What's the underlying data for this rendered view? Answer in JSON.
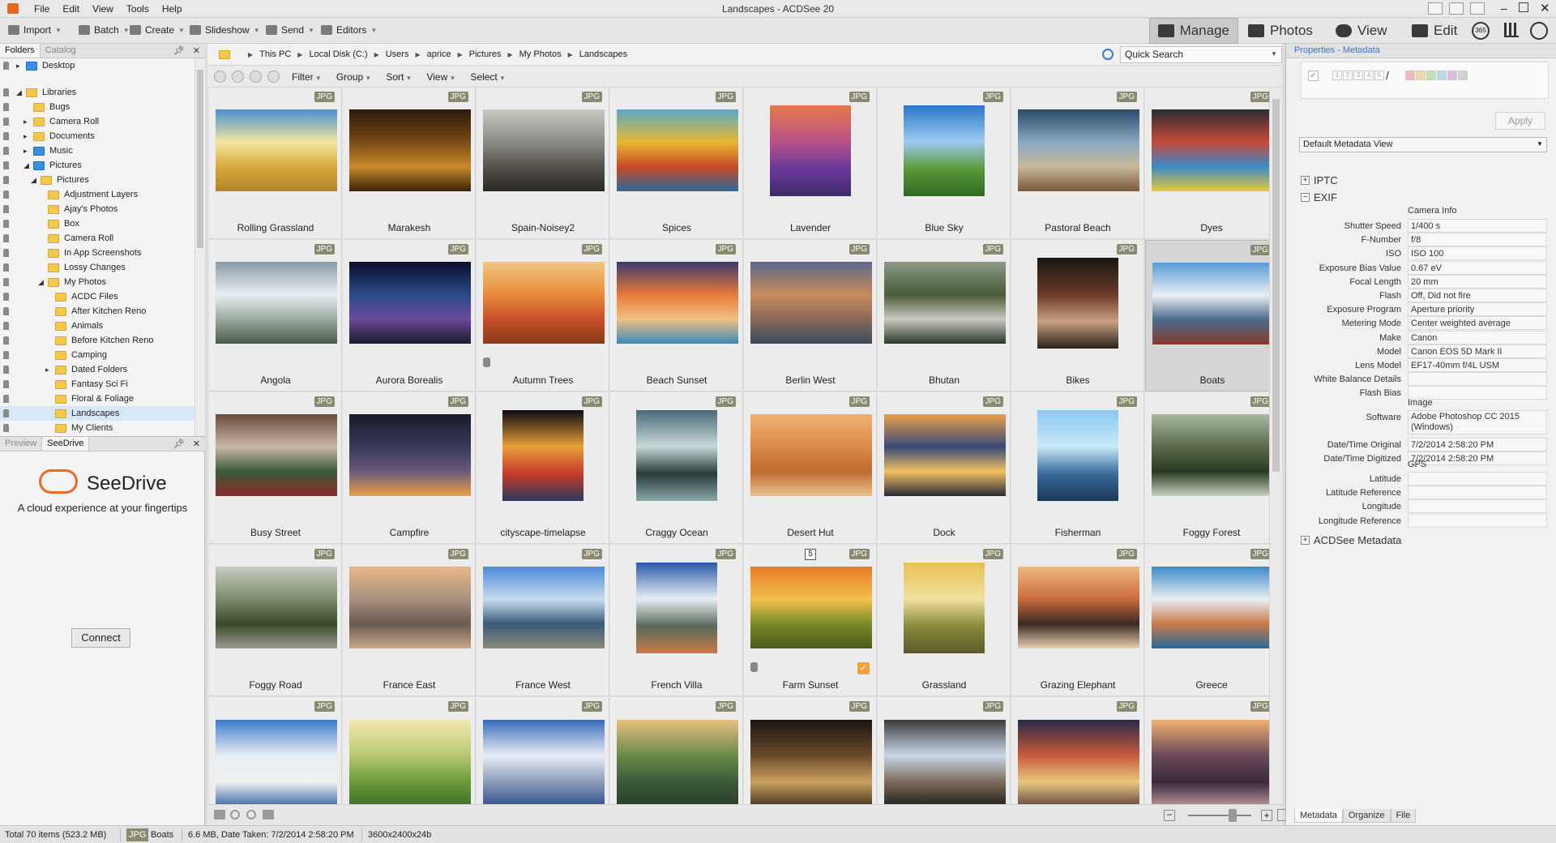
{
  "window": {
    "title": "Landscapes - ACDSee 20"
  },
  "menu": [
    "File",
    "Edit",
    "View",
    "Tools",
    "Help"
  ],
  "toolbar": {
    "import": "Import",
    "batch": "Batch",
    "create": "Create",
    "slideshow": "Slideshow",
    "send": "Send",
    "editors": "Editors"
  },
  "modes": {
    "manage": "Manage",
    "photos": "Photos",
    "view": "View",
    "edit": "Edit",
    "365_badge": "365"
  },
  "left_panel": {
    "tabs": [
      "Folders",
      "Catalog"
    ],
    "tree": [
      {
        "label": "Desktop",
        "level": 0,
        "icon": "blue-folder",
        "exp": "▸"
      },
      {
        "label": "Libraries",
        "level": 0,
        "icon": "folder",
        "exp": "◢"
      },
      {
        "label": "Bugs",
        "level": 1,
        "icon": "folder",
        "exp": ""
      },
      {
        "label": "Camera Roll",
        "level": 1,
        "icon": "folder",
        "exp": "▸"
      },
      {
        "label": "Documents",
        "level": 1,
        "icon": "folder",
        "exp": "▸"
      },
      {
        "label": "Music",
        "level": 1,
        "icon": "blue-folder",
        "exp": "▸"
      },
      {
        "label": "Pictures",
        "level": 1,
        "icon": "blue-folder",
        "exp": "◢"
      },
      {
        "label": "Pictures",
        "level": 2,
        "icon": "folder",
        "exp": "◢"
      },
      {
        "label": "Adjustment Layers",
        "level": 3,
        "icon": "folder",
        "exp": ""
      },
      {
        "label": "Ajay's Photos",
        "level": 3,
        "icon": "folder",
        "exp": ""
      },
      {
        "label": "Box",
        "level": 3,
        "icon": "folder",
        "exp": ""
      },
      {
        "label": "Camera Roll",
        "level": 3,
        "icon": "folder",
        "exp": ""
      },
      {
        "label": "In App Screenshots",
        "level": 3,
        "icon": "folder",
        "exp": ""
      },
      {
        "label": "Lossy Changes",
        "level": 3,
        "icon": "folder",
        "exp": ""
      },
      {
        "label": "My Photos",
        "level": 3,
        "icon": "folder",
        "exp": "◢"
      },
      {
        "label": "ACDC Files",
        "level": 4,
        "icon": "folder",
        "exp": ""
      },
      {
        "label": "After Kitchen Reno",
        "level": 4,
        "icon": "folder",
        "exp": ""
      },
      {
        "label": "Animals",
        "level": 4,
        "icon": "folder",
        "exp": ""
      },
      {
        "label": "Before Kitchen Reno",
        "level": 4,
        "icon": "folder",
        "exp": ""
      },
      {
        "label": "Camping",
        "level": 4,
        "icon": "folder",
        "exp": ""
      },
      {
        "label": "Dated Folders",
        "level": 4,
        "icon": "folder",
        "exp": "▸"
      },
      {
        "label": "Fantasy Sci Fi",
        "level": 4,
        "icon": "folder",
        "exp": ""
      },
      {
        "label": "Floral & Foliage",
        "level": 4,
        "icon": "folder",
        "exp": ""
      },
      {
        "label": "Landscapes",
        "level": 4,
        "icon": "folder",
        "exp": "",
        "selected": true
      },
      {
        "label": "My Clients",
        "level": 4,
        "icon": "folder",
        "exp": ""
      }
    ]
  },
  "seedrive_panel": {
    "tabs": [
      "Preview",
      "SeeDrive"
    ],
    "title": "SeeDrive",
    "tagline": "A cloud experience at your fingertips",
    "connect": "Connect"
  },
  "breadcrumb": [
    "This PC",
    "Local Disk (C:)",
    "Users",
    "aprice",
    "Pictures",
    "My Photos",
    "Landscapes"
  ],
  "quick_search": {
    "placeholder": "Quick Search"
  },
  "nav_menu": [
    "Filter",
    "Group",
    "Sort",
    "View",
    "Select"
  ],
  "badge_label": "JPG",
  "thumbnails": [
    {
      "name": "Rolling Grassland",
      "colors": [
        "#4a8fd0",
        "#f5e6a0",
        "#d6a83c",
        "#b08428"
      ]
    },
    {
      "name": "Marakesh",
      "colors": [
        "#2a1a0c",
        "#7a4a14",
        "#c88a2c",
        "#3a2208"
      ],
      "portrait": false
    },
    {
      "name": "Spain-Noisey2",
      "colors": [
        "#c9c9c4",
        "#8a8a84",
        "#56524c",
        "#2a2824"
      ]
    },
    {
      "name": "Spices",
      "colors": [
        "#5aa8c8",
        "#e8b830",
        "#c84a28",
        "#2c6a9a"
      ]
    },
    {
      "name": "Lavender",
      "colors": [
        "#e87a48",
        "#b8508a",
        "#6a3a9a",
        "#3e2a6a"
      ],
      "portrait": true
    },
    {
      "name": "Blue Sky",
      "colors": [
        "#2a78c8",
        "#9ccaf0",
        "#5a9a3a",
        "#2e6a22"
      ],
      "portrait": true
    },
    {
      "name": "Pastoral Beach",
      "colors": [
        "#2a4a6a",
        "#8aa8c0",
        "#c8b89a",
        "#7a5a3a"
      ]
    },
    {
      "name": "Dyes",
      "colors": [
        "#2a2e32",
        "#c84a3a",
        "#3a8ac8",
        "#e8c83a"
      ]
    },
    {
      "name": "Angola",
      "colors": [
        "#8a9aa8",
        "#e8eef2",
        "#9aa8a0",
        "#4a5a48"
      ]
    },
    {
      "name": "Aurora Borealis",
      "colors": [
        "#0a0e2a",
        "#2a4a8a",
        "#6a4a9a",
        "#1a1a2a"
      ]
    },
    {
      "name": "Autumn Trees",
      "colors": [
        "#f0c880",
        "#e88a3a",
        "#c8502a",
        "#8a3a1a"
      ],
      "db": true
    },
    {
      "name": "Beach Sunset",
      "colors": [
        "#3a3a6a",
        "#e87a3a",
        "#f0c080",
        "#3a8ab8"
      ]
    },
    {
      "name": "Berlin West",
      "colors": [
        "#5a6a8a",
        "#c88a5a",
        "#8a6a5a",
        "#3a4a5a"
      ]
    },
    {
      "name": "Bhutan",
      "colors": [
        "#8a9a88",
        "#4a5a3a",
        "#c8c8c0",
        "#2a3a2a"
      ]
    },
    {
      "name": "Bikes",
      "colors": [
        "#1a1612",
        "#6a3a2a",
        "#c8a080",
        "#2a2218"
      ],
      "portrait": true
    },
    {
      "name": "Boats",
      "colors": [
        "#5a9ad8",
        "#e8eef4",
        "#4a6a8a",
        "#8a3a2a"
      ],
      "selected": true
    },
    {
      "name": "Busy Street",
      "colors": [
        "#6a4a3a",
        "#c8b8a8",
        "#3a5a3a",
        "#8a2a2a"
      ]
    },
    {
      "name": "Campfire",
      "colors": [
        "#1a1a2a",
        "#3a3a5a",
        "#6a5a7a",
        "#e8a04a"
      ]
    },
    {
      "name": "cityscape-timelapse",
      "colors": [
        "#0a0a12",
        "#e8a03a",
        "#c83a2a",
        "#2a3a5a"
      ],
      "portrait": true
    },
    {
      "name": "Craggy Ocean",
      "colors": [
        "#4a6a7a",
        "#c8d8d8",
        "#2a3a3a",
        "#8aa8a8"
      ],
      "portrait": true
    },
    {
      "name": "Desert Hut",
      "colors": [
        "#f0b070",
        "#d88a4a",
        "#c06a30",
        "#e8c090"
      ]
    },
    {
      "name": "Dock",
      "colors": [
        "#e8a04a",
        "#3a4a7a",
        "#f0c060",
        "#2a2a3a"
      ]
    },
    {
      "name": "Fisherman",
      "colors": [
        "#8ac8f0",
        "#c8e8f8",
        "#3a6a9a",
        "#1a3a5a"
      ],
      "portrait": true
    },
    {
      "name": "Foggy Forest",
      "colors": [
        "#a8b8a0",
        "#5a6a4a",
        "#2a3a22",
        "#c8d0c0"
      ]
    },
    {
      "name": "Foggy Road",
      "colors": [
        "#c8ccc4",
        "#7a8a6a",
        "#3a4a2a",
        "#9a9a90"
      ]
    },
    {
      "name": "France East",
      "colors": [
        "#e8b888",
        "#a89080",
        "#6a5a50",
        "#c8a888"
      ]
    },
    {
      "name": "France West",
      "colors": [
        "#4a8ad8",
        "#c8dcef",
        "#3a5a7a",
        "#8a8a7a"
      ]
    },
    {
      "name": "French Villa",
      "colors": [
        "#2a5aa8",
        "#e8eef4",
        "#5a6a5a",
        "#c87a4a"
      ],
      "portrait": true
    },
    {
      "name": "Farm Sunset",
      "colors": [
        "#e87a2a",
        "#f0c04a",
        "#7a8a2a",
        "#4a5a1a"
      ],
      "db": true,
      "check": true,
      "num": "5"
    },
    {
      "name": "Grassland",
      "colors": [
        "#e8c050",
        "#f0e0a0",
        "#8a8a3a",
        "#5a5a2a"
      ],
      "portrait": true
    },
    {
      "name": "Grazing Elephant",
      "colors": [
        "#f0b880",
        "#c86a3a",
        "#3a2a22",
        "#e8d0b0"
      ]
    },
    {
      "name": "Greece",
      "colors": [
        "#3a8ac8",
        "#e8eef2",
        "#c87a4a",
        "#2a6a9a"
      ]
    },
    {
      "name": "",
      "colors": [
        "#3a7ac8",
        "#e8eef4",
        "#f0f0f0",
        "#2a5a9a"
      ],
      "partial": true
    },
    {
      "name": "",
      "colors": [
        "#f0e8b0",
        "#b8c870",
        "#6a9a3a",
        "#3a6a2a"
      ],
      "partial": true
    },
    {
      "name": "",
      "colors": [
        "#3a6ab8",
        "#e8eef8",
        "#8a9ab8",
        "#2a4a8a"
      ],
      "partial": true
    },
    {
      "name": "",
      "colors": [
        "#e8c080",
        "#6a8a4a",
        "#3a5a3a",
        "#2a3a2a"
      ],
      "partial": true
    },
    {
      "name": "",
      "colors": [
        "#1a1612",
        "#6a4a2a",
        "#c8a060",
        "#3a2a1a"
      ],
      "partial": true
    },
    {
      "name": "",
      "colors": [
        "#3a3a3a",
        "#c8d8e8",
        "#7a6a5a",
        "#1a1a1a"
      ],
      "partial": true
    },
    {
      "name": "",
      "colors": [
        "#2a2a4a",
        "#c85a3a",
        "#e8c880",
        "#5a3a3a"
      ],
      "partial": true
    },
    {
      "name": "",
      "colors": [
        "#f0b070",
        "#6a4a5a",
        "#3a2a3a",
        "#c8a0a0"
      ],
      "partial": true
    }
  ],
  "bottom_bar": {},
  "properties": {
    "title": "Properties - Metadata",
    "ratings": [
      "1",
      "2",
      "3",
      "4",
      "5"
    ],
    "label_colors": [
      "#f2b8bb",
      "#f0d9a8",
      "#bfe1b3",
      "#b8d8ec",
      "#ddb8e0",
      "#d2d2d2"
    ],
    "apply": "Apply",
    "view_select": "Default Metadata View",
    "sections": {
      "iptc": "IPTC",
      "exif": "EXIF",
      "acdsee": "ACDSee Metadata"
    },
    "groups": {
      "camera": "Camera Info",
      "image": "Image",
      "gps": "GPS"
    },
    "camera_rows": [
      {
        "k": "Shutter Speed",
        "v": "1/400 s"
      },
      {
        "k": "F-Number",
        "v": "f/8"
      },
      {
        "k": "ISO",
        "v": "ISO 100"
      },
      {
        "k": "Exposure Bias Value",
        "v": "0.67 eV"
      },
      {
        "k": "Focal Length",
        "v": "20 mm"
      },
      {
        "k": "Flash",
        "v": "Off, Did not fire"
      },
      {
        "k": "Exposure Program",
        "v": "Aperture priority"
      },
      {
        "k": "Metering Mode",
        "v": "Center weighted average"
      },
      {
        "k": "Make",
        "v": "Canon"
      },
      {
        "k": "Model",
        "v": "Canon EOS 5D Mark II"
      },
      {
        "k": "Lens Model",
        "v": "EF17-40mm f/4L USM"
      },
      {
        "k": "White Balance Details",
        "v": ""
      },
      {
        "k": "Flash Bias",
        "v": ""
      }
    ],
    "image_rows": [
      {
        "k": "Software",
        "v": "Adobe Photoshop CC 2015 (Windows)",
        "tall": true
      },
      {
        "k": "Date/Time Original",
        "v": "7/2/2014 2:58:20 PM"
      },
      {
        "k": "Date/Time Digitized",
        "v": "7/2/2014 2:58:20 PM"
      }
    ],
    "gps_rows": [
      {
        "k": "Latitude",
        "v": ""
      },
      {
        "k": "Latitude Reference",
        "v": ""
      },
      {
        "k": "Longitude",
        "v": ""
      },
      {
        "k": "Longitude Reference",
        "v": ""
      }
    ],
    "tabs": [
      "Metadata",
      "Organize",
      "File"
    ]
  },
  "status": {
    "total": "Total 70 items  (523.2 MB)",
    "type": "JPG",
    "name": "Boats",
    "info": "6.6 MB, Date Taken: 7/2/2014 2:58:20 PM",
    "dims": "3600x2400x24b"
  }
}
